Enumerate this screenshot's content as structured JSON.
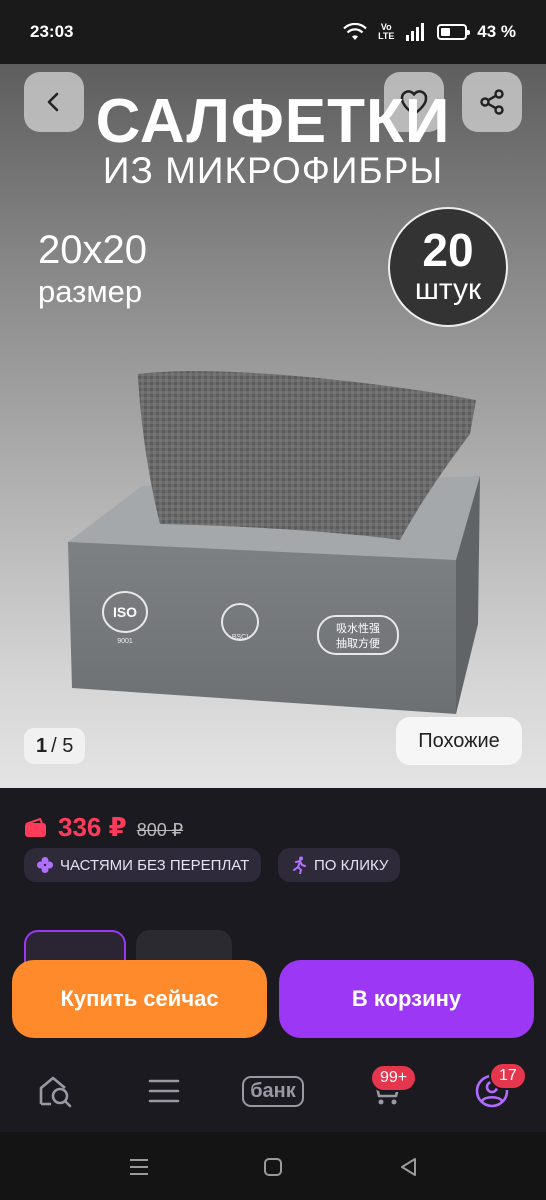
{
  "status_bar": {
    "time": "23:03",
    "network_label": "Vo LTE",
    "battery_percent": "43 %",
    "battery_level": 0.43
  },
  "hero": {
    "title": "САЛФЕТКИ",
    "subtitle": "ИЗ МИКРОФИБРЫ",
    "size_value": "20х20",
    "size_label": "размер",
    "count_value": "20",
    "count_label": "штук",
    "box_badges": [
      "ISO",
      "9001",
      "BSCI",
      "吸水性强",
      "抽取方便"
    ],
    "pager_current": "1",
    "pager_total": "/ 5",
    "similar_label": "Похожие"
  },
  "price": {
    "current": "336 ₽",
    "old": "800 ₽",
    "chip_installments": "ЧАСТЯМИ БЕЗ ПЕРЕПЛАТ",
    "chip_one_click": "ПО КЛИКУ",
    "accent_color": "#ff3b5c"
  },
  "actions": {
    "buy_now": "Купить сейчас",
    "add_to_cart": "В корзину"
  },
  "bottom_nav": {
    "items": [
      {
        "icon": "home-search-icon"
      },
      {
        "icon": "catalog-menu-icon"
      },
      {
        "icon": "bank-icon",
        "label": "банк"
      },
      {
        "icon": "cart-icon",
        "badge": "99+"
      },
      {
        "icon": "profile-icon",
        "badge": "17"
      }
    ]
  },
  "colors": {
    "buy": "#ff8a2b",
    "cart": "#9b37f5",
    "badge": "#e5364e",
    "chip_text": "#e6e1f3"
  }
}
